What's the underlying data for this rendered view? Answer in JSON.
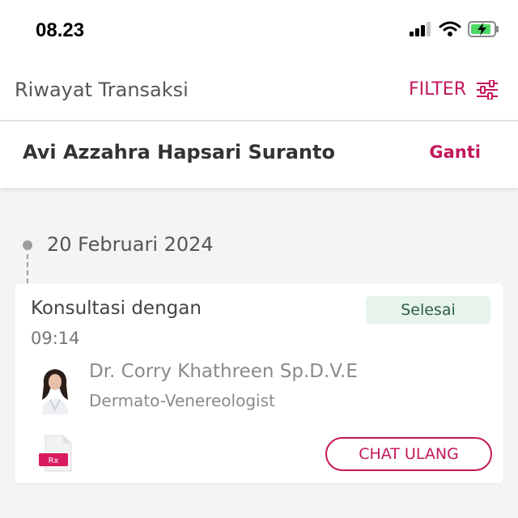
{
  "status_bar": {
    "time": "08.23"
  },
  "header": {
    "title": "Riwayat Transaksi",
    "filter_label": "FILTER"
  },
  "user": {
    "name": "Avi Azzahra Hapsari Suranto",
    "change_label": "Ganti"
  },
  "timeline": {
    "date": "20 Februari 2024",
    "card": {
      "title": "Konsultasi dengan",
      "time": "09:14",
      "status": "Selesai",
      "doctor_name": "Dr. Corry Khathreen Sp.D.V.E",
      "doctor_specialty": "Dermato-Venereologist",
      "prescription_badge": "Rx",
      "chat_button": "CHAT ULANG"
    }
  },
  "colors": {
    "accent": "#c2185b",
    "status_bg": "#e6f4ec",
    "status_text": "#2e5e46"
  }
}
